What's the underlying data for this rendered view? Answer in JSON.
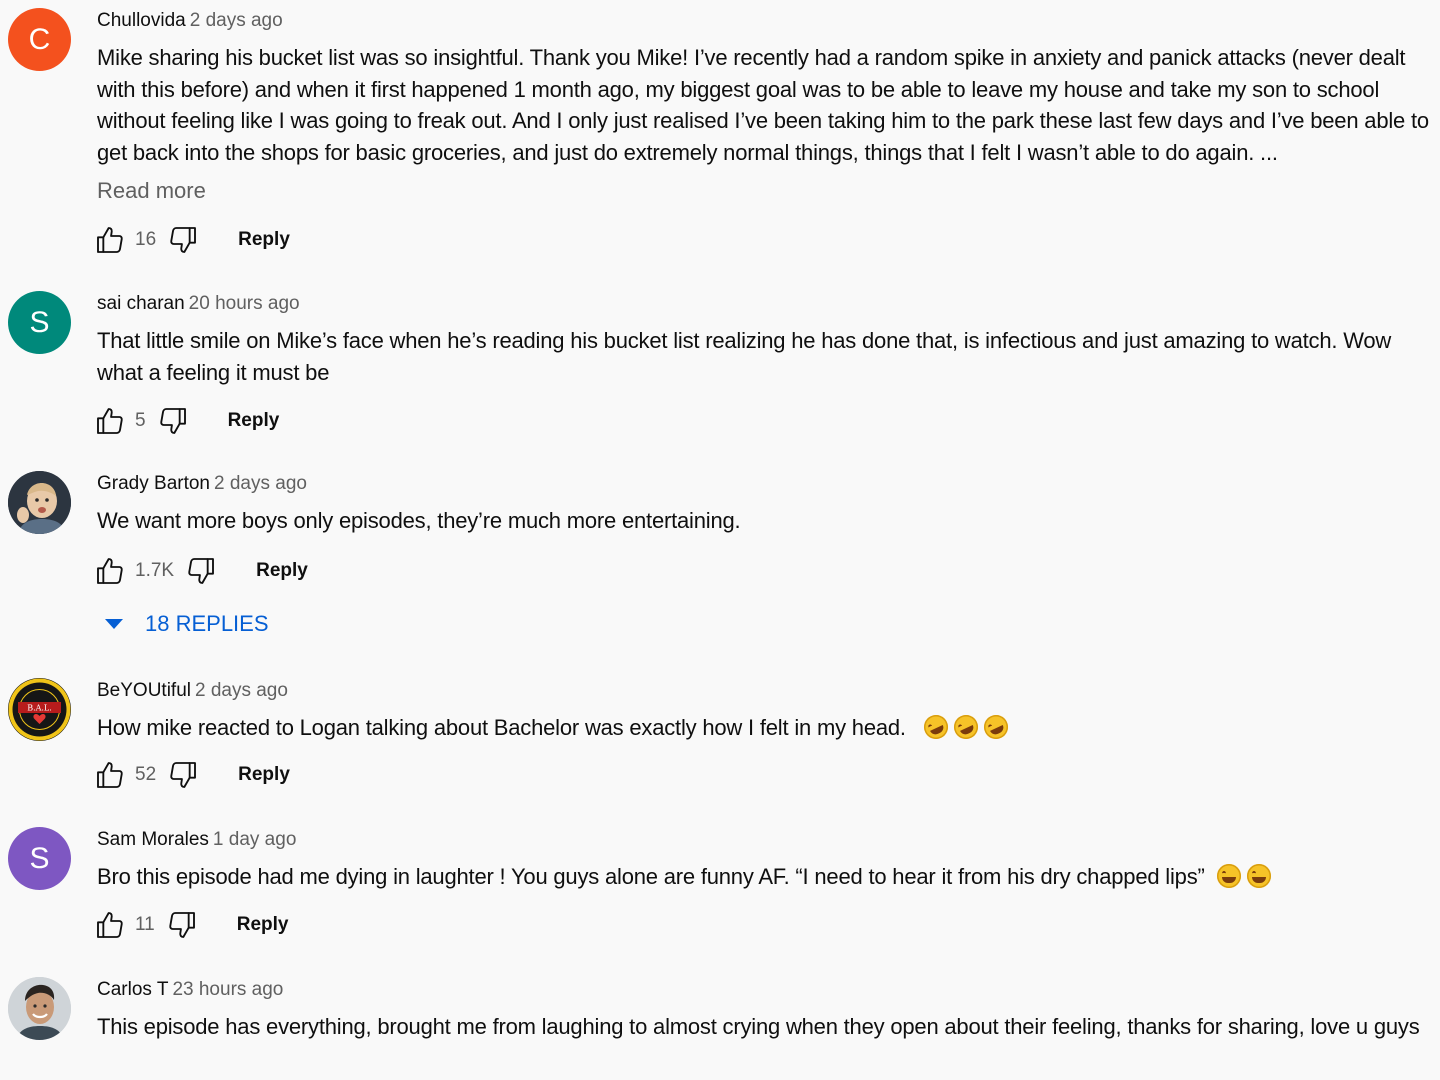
{
  "actions": {
    "reply_label": "Reply"
  },
  "comments": [
    {
      "author": "Chullovida",
      "time": "2 days ago",
      "avatar_letter": "C",
      "avatar_color": "#f4511e",
      "text": "Mike sharing his bucket list was so insightful. Thank you Mike! I’ve recently had a random spike in anxiety and panick attacks (never dealt with this before) and when it first happened 1 month ago, my biggest goal was to be able to leave my house and take my son to school without feeling like I was going to freak out. And I only just realised I’ve been taking him to the park these last few days and I’ve been able to get back into the shops for basic groceries, and just do extremely normal things, things that I felt I wasn’t able to do again. ...",
      "read_more": "Read more",
      "likes": "16"
    },
    {
      "author": "sai charan",
      "time": "20 hours ago",
      "avatar_letter": "S",
      "avatar_color": "#00897b",
      "text": "That little smile on Mike’s face when he’s reading his bucket list realizing he has done that, is infectious and just amazing to watch. Wow what a feeling it must be",
      "likes": "5"
    },
    {
      "author": "Grady Barton",
      "time": "2 days ago",
      "text": "We want more boys only episodes, they’re much more entertaining.",
      "likes": "1.7K",
      "replies_label": "18 REPLIES"
    },
    {
      "author": "BeYOUtiful",
      "time": "2 days ago",
      "avatar_text": "B.A.L.",
      "text": "How mike reacted to Logan talking about Bachelor was exactly how I felt in my head.",
      "emoji": [
        "rolling-on-floor-laughing",
        "rolling-on-floor-laughing",
        "rolling-on-floor-laughing"
      ],
      "likes": "52"
    },
    {
      "author": "Sam Morales",
      "time": "1 day ago",
      "avatar_letter": "S",
      "avatar_color": "#7e57c2",
      "text": "Bro this episode had me dying in laughter ! You guys alone are funny AF. “I need to hear it from his dry chapped lips”",
      "emoji": [
        "face-with-tears-of-joy",
        "face-with-tears-of-joy"
      ],
      "likes": "11"
    },
    {
      "author": "Carlos T",
      "time": "23 hours ago",
      "text": "This episode has everything, brought me from laughing to almost crying when they open about their feeling, thanks for sharing, love u guys"
    }
  ]
}
